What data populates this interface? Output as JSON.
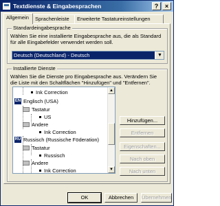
{
  "window": {
    "title": "Textdienste & Eingabesprachen",
    "help_button": "?",
    "close_button": "×"
  },
  "tabs": [
    {
      "label": "Allgemein",
      "active": true
    },
    {
      "label": "Sprachenleiste",
      "active": false
    },
    {
      "label": "Erweiterte Tastatureinstellungen",
      "active": false
    }
  ],
  "default_language": {
    "group_title": "Standardeingabesprache",
    "description": "Wählen Sie eine installierte Eingabesprache aus, die als Standard für alle Eingabefelder verwendet werden soll.",
    "selected": "Deutsch (Deutschland) - Deutsch"
  },
  "installed_services": {
    "group_title": "Installierte Dienste",
    "description": "Wählen Sie die Dienste pro Eingabesprache aus. Verändern Sie die Liste mit den Schaltflächen \"Hinzufügen\" und \"Entfernen\".",
    "tree": [
      {
        "label": "Ink Correction",
        "kind": "item"
      },
      {
        "label": "Englisch (USA)",
        "kind": "language",
        "badge": "EN"
      },
      {
        "label": "Tastatur",
        "kind": "keyboard"
      },
      {
        "label": "US",
        "kind": "item"
      },
      {
        "label": "Andere",
        "kind": "keyboard"
      },
      {
        "label": "Ink Correction",
        "kind": "item"
      },
      {
        "label": "Russisch (Russische Föderation)",
        "kind": "language",
        "badge": "RU"
      },
      {
        "label": "Tastatur",
        "kind": "keyboard"
      },
      {
        "label": "Russisch",
        "kind": "item"
      },
      {
        "label": "Andere",
        "kind": "keyboard"
      },
      {
        "label": "Ink Correction",
        "kind": "item"
      }
    ]
  },
  "side_buttons": {
    "add": "Hinzufügen...",
    "remove": "Entfernen",
    "properties": "Eigenschaften...",
    "move_up": "Nach oben",
    "move_down": "Nach unten"
  },
  "bottom_buttons": {
    "ok": "OK",
    "cancel": "Abbrechen",
    "apply": "Übernehmen"
  },
  "colors": {
    "titlebar": "#0a246a",
    "selection": "#0a246a",
    "face": "#ece9d8"
  }
}
